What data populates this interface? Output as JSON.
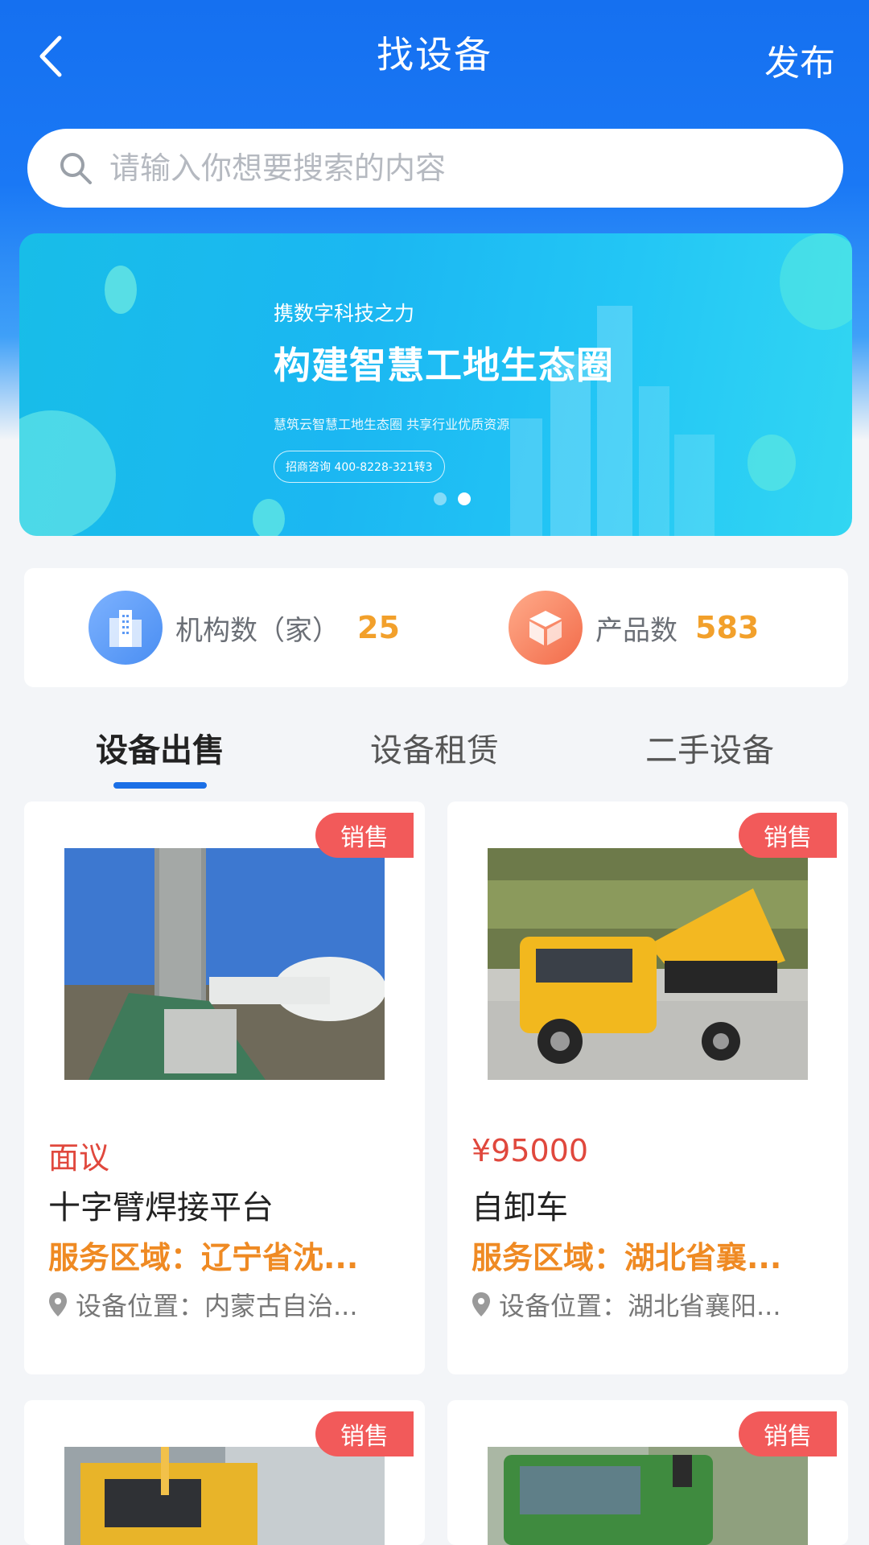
{
  "nav": {
    "title": "找设备",
    "publish": "发布"
  },
  "search": {
    "placeholder": "请输入你想要搜索的内容"
  },
  "banner": {
    "kicker": "携数字科技之力",
    "headline": "构建智慧工地生态圈",
    "subtitle": "慧筑云智慧工地生态圈 共享行业优质资源",
    "contact": "招商咨询 400-8228-321转3",
    "slides_total": 2,
    "active_slide": 2
  },
  "stats": {
    "orgs": {
      "label": "机构数（家）",
      "value": "25"
    },
    "products": {
      "label": "产品数",
      "value": "583"
    }
  },
  "tabs": [
    {
      "label": "设备出售",
      "active": true
    },
    {
      "label": "设备租赁",
      "active": false
    },
    {
      "label": "二手设备",
      "active": false
    }
  ],
  "cards": [
    {
      "badge": "销售",
      "price": "面议",
      "name": "十字臂焊接平台",
      "area": "服务区域：辽宁省沈...",
      "location": "设备位置：内蒙古自治..."
    },
    {
      "badge": "销售",
      "price": "¥95000",
      "name": "自卸车",
      "area": "服务区域：湖北省襄...",
      "location": "设备位置：湖北省襄阳..."
    },
    {
      "badge": "销售"
    },
    {
      "badge": "销售"
    }
  ],
  "colors": {
    "primary": "#1a6fe6",
    "price": "#e0483d",
    "area": "#ef8a23",
    "stat_value": "#f2a02b",
    "badge": "#f25a5a"
  }
}
